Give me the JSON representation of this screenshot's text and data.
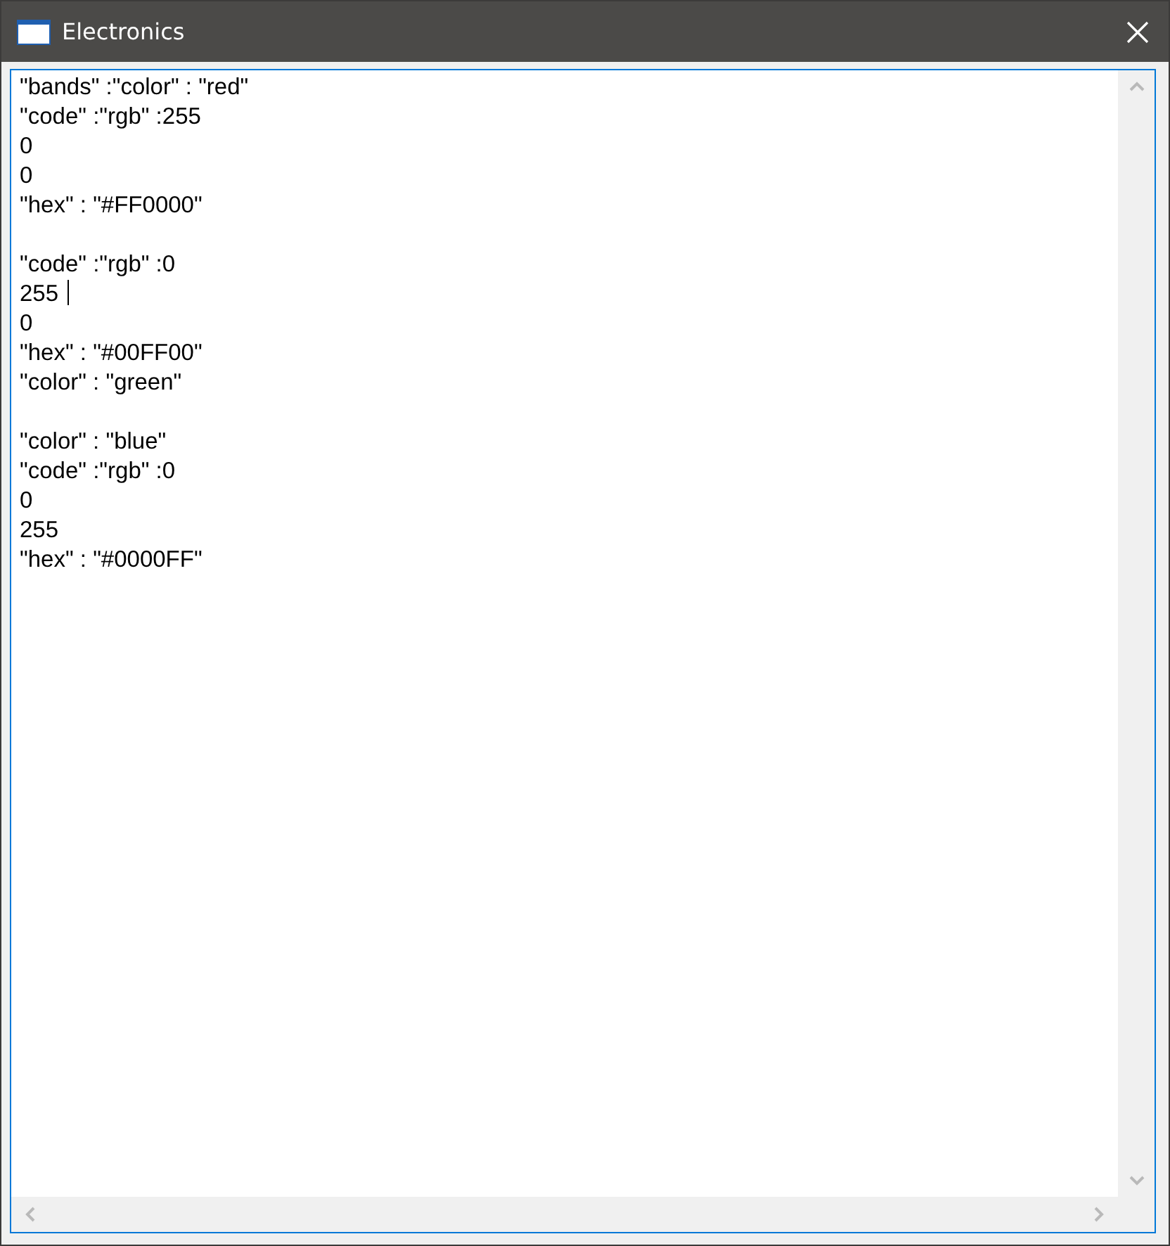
{
  "window": {
    "title": "Electronics"
  },
  "editor": {
    "lines": [
      {
        "kind": "text",
        "text": "\"bands\" :\"color\" : \"red\"",
        "caret": false
      },
      {
        "kind": "text",
        "text": "\"code\" :\"rgb\" :255",
        "caret": false
      },
      {
        "kind": "text",
        "text": "0",
        "caret": false
      },
      {
        "kind": "text",
        "text": "0",
        "caret": false
      },
      {
        "kind": "text",
        "text": "\"hex\" : \"#FF0000\"",
        "caret": false
      },
      {
        "kind": "blank"
      },
      {
        "kind": "text",
        "text": "\"code\" :\"rgb\" :0",
        "caret": false
      },
      {
        "kind": "text",
        "text": "255 ",
        "caret": true
      },
      {
        "kind": "text",
        "text": "0",
        "caret": false
      },
      {
        "kind": "text",
        "text": "\"hex\" : \"#00FF00\"",
        "caret": false
      },
      {
        "kind": "text",
        "text": "\"color\" : \"green\"",
        "caret": false
      },
      {
        "kind": "blank"
      },
      {
        "kind": "text",
        "text": "\"color\" : \"blue\"",
        "caret": false
      },
      {
        "kind": "text",
        "text": "\"code\" :\"rgb\" :0",
        "caret": false
      },
      {
        "kind": "text",
        "text": "0",
        "caret": false
      },
      {
        "kind": "text",
        "text": "255",
        "caret": false
      },
      {
        "kind": "text",
        "text": "\"hex\" : \"#0000FF\"",
        "caret": false
      }
    ]
  }
}
